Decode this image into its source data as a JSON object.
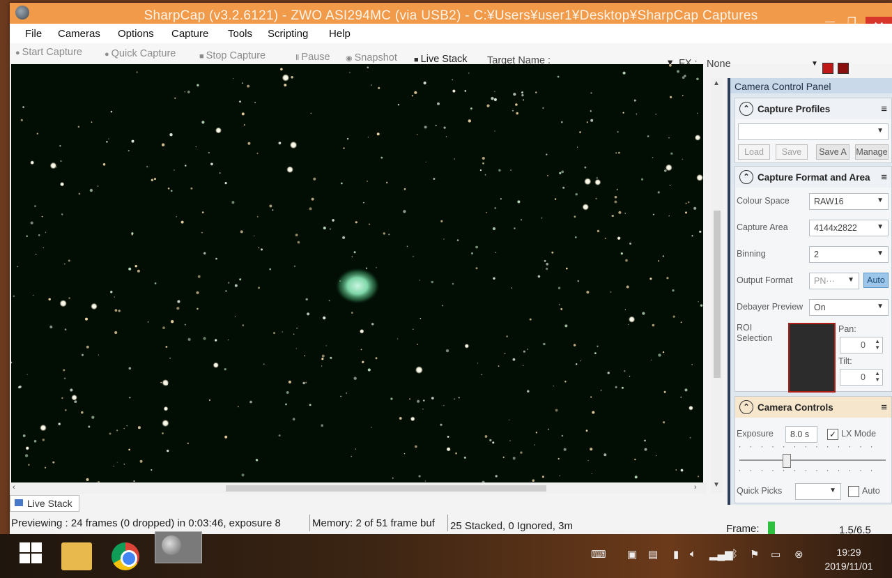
{
  "window": {
    "title": "SharpCap (v3.2.6121) - ZWO ASI294MC (via USB2) - C:¥Users¥user1¥Desktop¥SharpCap Captures",
    "minimize": "—",
    "maximize": "❐",
    "close": "✕"
  },
  "menu": {
    "file": "File",
    "cameras": "Cameras",
    "options": "Options",
    "capture": "Capture",
    "tools": "Tools",
    "scripting": "Scripting",
    "help": "Help"
  },
  "toolbar": {
    "start_capture": "Start Capture",
    "quick_capture": "Quick Capture",
    "stop_capture": "Stop Capture",
    "pause": "Pause",
    "snapshot": "Snapshot",
    "live_stack": "Live Stack",
    "target_name_label": "Target Name :",
    "fx_label": "FX :",
    "fx_value": "None"
  },
  "viewer_tab": {
    "label": "Live Stack"
  },
  "status": {
    "previewing": "Previewing : 24 frames (0 dropped) in 0:03:46, exposure 8",
    "memory": "Memory: 2 of 51 frame buf",
    "stacked": "25 Stacked, 0 Ignored, 3m",
    "frame_label": "Frame:",
    "zoom": "1.5/6.5"
  },
  "panel": {
    "header": "Camera Control Panel",
    "capture_profiles": {
      "title": "Capture Profiles",
      "selected": "",
      "load": "Load",
      "save": "Save",
      "save_as": "Save A",
      "manage": "Manage"
    },
    "capture_format": {
      "title": "Capture Format and Area",
      "colour_space_label": "Colour Space",
      "colour_space": "RAW16",
      "capture_area_label": "Capture Area",
      "capture_area": "4144x2822",
      "binning_label": "Binning",
      "binning": "2",
      "output_format_label": "Output Format",
      "output_format": "PN···",
      "auto": "Auto",
      "debayer_label": "Debayer Preview",
      "debayer": "On",
      "roi_label": "ROI Selection",
      "pan_label": "Pan:",
      "pan": "0",
      "tilt_label": "Tilt:",
      "tilt": "0"
    },
    "camera_controls": {
      "title": "Camera Controls",
      "exposure_label": "Exposure",
      "exposure": "8.0 s",
      "lx_mode": "LX Mode",
      "quick_picks_label": "Quick Picks",
      "auto_label": "Auto"
    }
  },
  "taskbar": {
    "time": "19:29",
    "date": "2019/11/01"
  },
  "colors": {
    "title_bar": "#f19a4a",
    "close_button": "#d9362b",
    "sky": "#020d04",
    "nebula": "#7fd6a8",
    "roi_border": "#b02018",
    "frame_indicator": "#30c040"
  }
}
